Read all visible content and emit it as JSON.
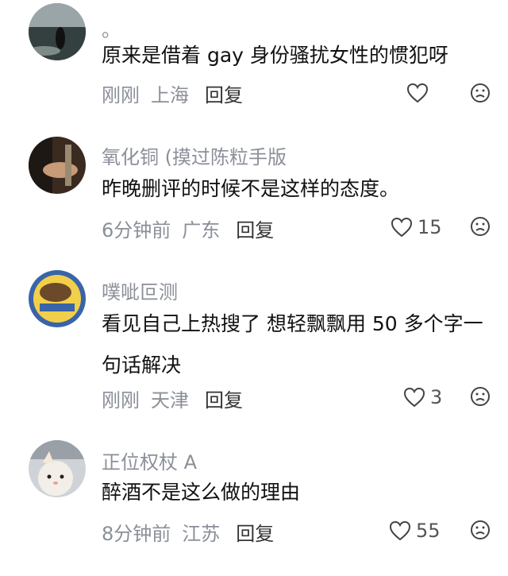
{
  "comments": [
    {
      "username": "。",
      "text": "原来是借着 gay 身份骚扰女性的惯犯呀",
      "time": "刚刚",
      "location": "上海",
      "reply_label": "回复",
      "likes": ""
    },
    {
      "username": "氧化铜 (摸过陈粒手版",
      "text": "昨晚删评的时候不是这样的态度。",
      "time": "6分钟前",
      "location": "广东",
      "reply_label": "回复",
      "likes": "15"
    },
    {
      "username": "噗呲叵测",
      "text": "看见自己上热搜了 想轻飘飘用 50 多个字一句话解决",
      "time": "刚刚",
      "location": "天津",
      "reply_label": "回复",
      "likes": "3"
    },
    {
      "username": "正位权杖 A",
      "text": "醉酒不是这么做的理由",
      "time": "8分钟前",
      "location": "江苏",
      "reply_label": "回复",
      "likes": "55"
    }
  ],
  "icons": {
    "like": "heart-outline-icon",
    "dislike": "frown-face-icon"
  },
  "colors": {
    "meta_gray": "#8b8f99",
    "text_black": "#111111"
  }
}
